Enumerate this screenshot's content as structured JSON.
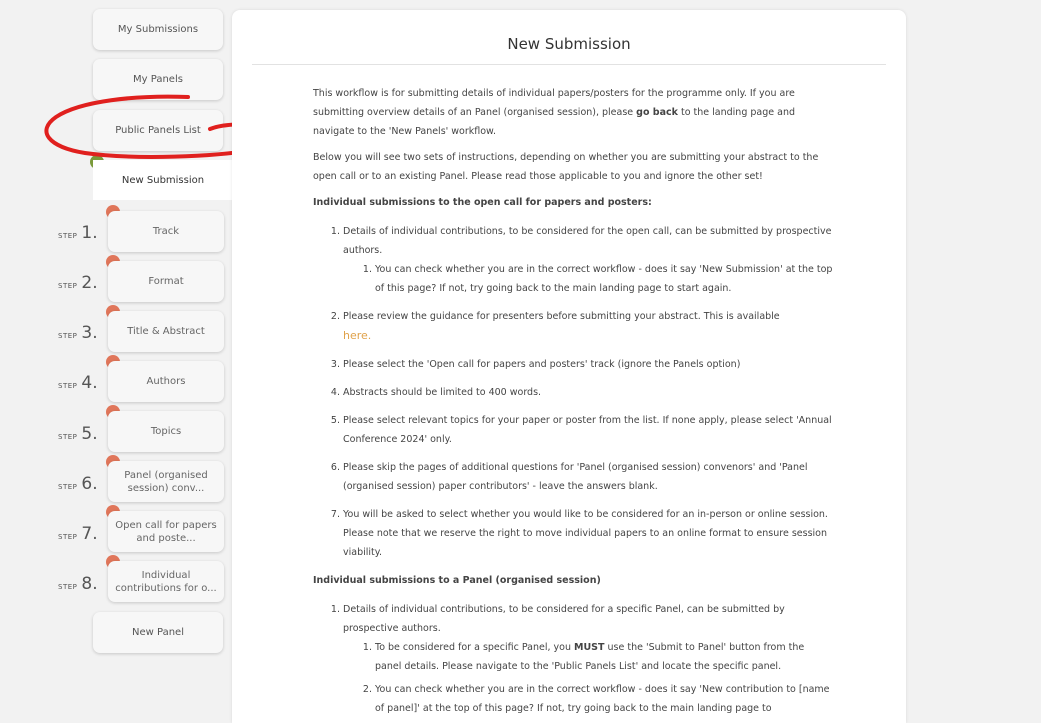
{
  "sidebar": {
    "my_submissions": "My Submissions",
    "my_panels": "My Panels",
    "public_panels": "Public Panels List",
    "new_submission": "New Submission",
    "new_panel": "New Panel",
    "step_word": "STEP",
    "steps": [
      {
        "num": "1.",
        "label": "Track"
      },
      {
        "num": "2.",
        "label": "Format"
      },
      {
        "num": "3.",
        "label": "Title & Abstract"
      },
      {
        "num": "4.",
        "label": "Authors"
      },
      {
        "num": "5.",
        "label": "Topics"
      },
      {
        "num": "6.",
        "label": "Panel (organised session) conv..."
      },
      {
        "num": "7.",
        "label": "Open call for papers and poste..."
      },
      {
        "num": "8.",
        "label": "Individual contributions for o..."
      }
    ]
  },
  "colors": {
    "step_dot": "#e0765a",
    "active_dot": "#7a9a3a",
    "annotation": "#e0201e",
    "link": "#e0a24a"
  },
  "main": {
    "title": "New Submission",
    "intro1_a": "This workflow is for submitting details of individual papers/posters for the programme only. If you are submitting overview details of an Panel (organised session), please ",
    "intro1_bold": "go back",
    "intro1_b": " to the landing page and navigate to the 'New Panels' workflow.",
    "intro2": "Below you will see two sets of instructions, depending on whether you are submitting your abstract to the open call or to an existing Panel. Please read those applicable to you and ignore the other set!",
    "section1_heading": "Individual submissions to the open call for papers and posters:",
    "s1_item1": "Details of individual contributions, to be considered for the open call, can be submitted by prospective authors.",
    "s1_item1_sub1": "You can check whether you are in the correct workflow - does it say 'New Submission' at the top of this page? If not, try going back to the main landing page to start again.",
    "s1_item2": "Please review the guidance for presenters before submitting your abstract. This is available",
    "s1_item2_link": "here.",
    "s1_item3": "Please select the 'Open call for papers and posters' track (ignore the Panels option)",
    "s1_item4": "Abstracts should be limited to 400 words.",
    "s1_item5": "Please select relevant topics for your paper or poster from the list. If none apply, please select 'Annual Conference 2024' only.",
    "s1_item6": "Please skip the pages of additional questions for 'Panel (organised session) convenors' and 'Panel (organised session) paper contributors' - leave the answers blank.",
    "s1_item7": "You will be asked to select whether you would like to be considered for an in-person or online session. Please note that we reserve the right to move individual papers to an online format to ensure session viability.",
    "section2_heading": "Individual submissions to a Panel (organised session)",
    "s2_item1": "Details of individual contributions, to be considered for a specific Panel, can be submitted by prospective authors.",
    "s2_item1_sub1_a": "To be considered for a specific Panel, you ",
    "s2_item1_sub1_bold": "MUST",
    "s2_item1_sub1_b": " use the 'Submit to Panel' button from the panel details. Please navigate to the 'Public Panels List' and locate the specific panel.",
    "s2_item1_sub2": "You can check whether you are in the correct workflow - does it say 'New contribution to [name of panel]' at the top of this page? If not, try going back to the main landing page to"
  }
}
